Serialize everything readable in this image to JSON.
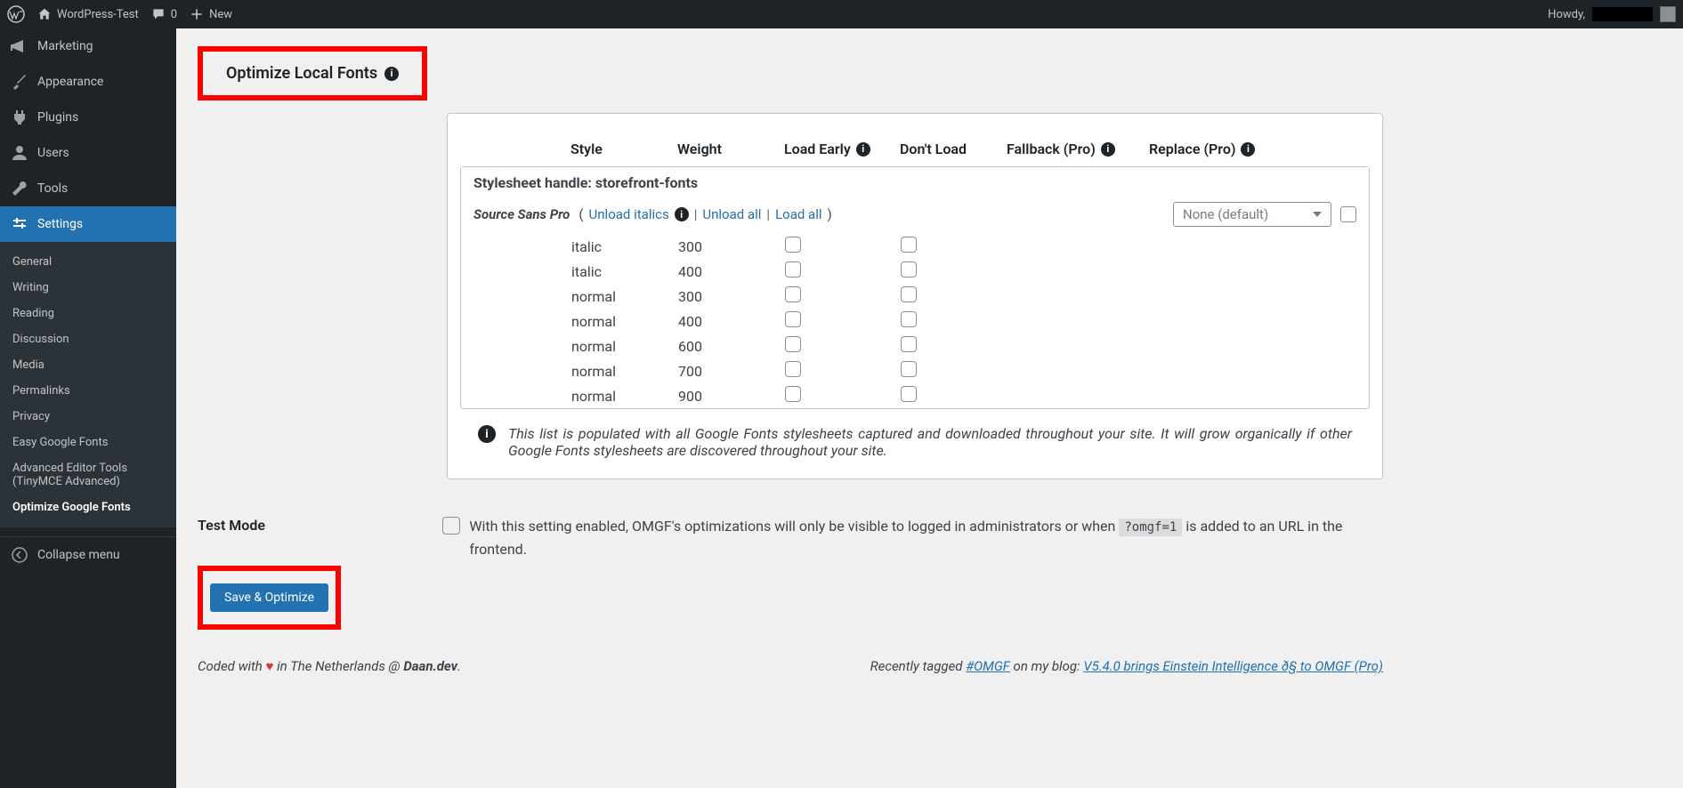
{
  "adminbar": {
    "site_name": "WordPress-Test",
    "comments": "0",
    "new": "New",
    "howdy": "Howdy,"
  },
  "sidebar": {
    "marketing": "Marketing",
    "appearance": "Appearance",
    "plugins": "Plugins",
    "users": "Users",
    "tools": "Tools",
    "settings": "Settings",
    "submenu": {
      "general": "General",
      "writing": "Writing",
      "reading": "Reading",
      "discussion": "Discussion",
      "media": "Media",
      "permalinks": "Permalinks",
      "privacy": "Privacy",
      "easy_google": "Easy Google Fonts",
      "adv_editor_1": "Advanced Editor Tools",
      "adv_editor_2": "(TinyMCE Advanced)",
      "optimize_google": "Optimize Google Fonts"
    },
    "collapse": "Collapse menu"
  },
  "section": {
    "title": "Optimize Local Fonts"
  },
  "table": {
    "headers": {
      "style": "Style",
      "weight": "Weight",
      "load_early": "Load Early",
      "dont_load": "Don't Load",
      "fallback": "Fallback (Pro)",
      "replace": "Replace (Pro)"
    },
    "handle_prefix": "Stylesheet handle: ",
    "handle": "storefront-fonts",
    "family": "Source Sans Pro",
    "unload_italics": "Unload italics",
    "unload_all": "Unload all",
    "load_all": "Load all",
    "fallback_default": "None (default)",
    "variants": [
      {
        "style": "italic",
        "weight": "300"
      },
      {
        "style": "italic",
        "weight": "400"
      },
      {
        "style": "normal",
        "weight": "300"
      },
      {
        "style": "normal",
        "weight": "400"
      },
      {
        "style": "normal",
        "weight": "600"
      },
      {
        "style": "normal",
        "weight": "700"
      },
      {
        "style": "normal",
        "weight": "900"
      }
    ],
    "note": "This list is populated with all Google Fonts stylesheets captured and downloaded throughout your site. It will grow organically if other Google Fonts stylesheets are discovered throughout your site."
  },
  "test_mode": {
    "label": "Test Mode",
    "desc_before": "With this setting enabled, OMGF's optimizations will only be visible to logged in administrators or when",
    "code": "?omgf=1",
    "desc_after": "is added to an URL in the frontend."
  },
  "save_btn": "Save & Optimize",
  "footer": {
    "coded_1": "Coded with",
    "coded_2": "in The Netherlands @",
    "author": "Daan.dev",
    "recent_1": "Recently tagged",
    "hashtag": "#OMGF",
    "recent_2": "on my blog:",
    "post_title": "V5.4.0 brings Einstein Intelligence ð§  to OMGF (Pro)"
  }
}
